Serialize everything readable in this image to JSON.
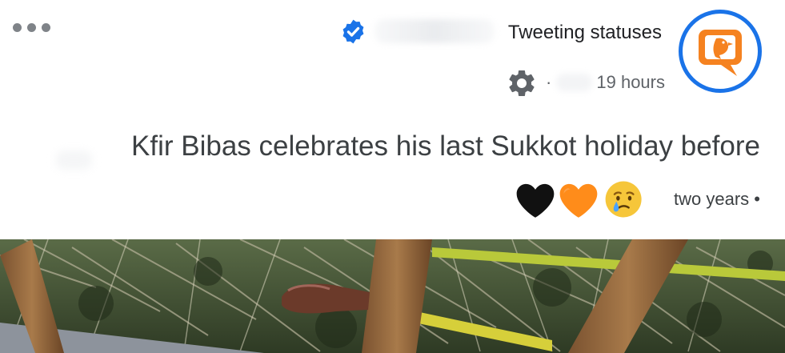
{
  "header": {
    "channel_name": "Tweeting statuses",
    "time_ago": "19 hours",
    "separator": "·"
  },
  "post": {
    "text": "Kfir Bibas celebrates his last Sukkot holiday before",
    "age": "two years •",
    "reactions": [
      "black-heart",
      "orange-heart",
      "crying-face"
    ]
  },
  "icons": {
    "more": "more-horizontal-icon",
    "verified": "verified-badge-icon",
    "settings": "gear-icon",
    "avatar": "bird-speech-bubble-logo"
  },
  "colors": {
    "verified_blue": "#1a73e8",
    "avatar_ring": "#1a73e8",
    "logo_orange": "#f58220",
    "text_primary": "#3c4043",
    "text_secondary": "#5f6368"
  }
}
